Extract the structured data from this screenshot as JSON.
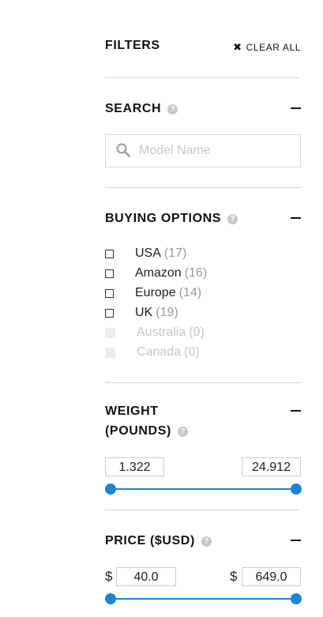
{
  "header": {
    "title": "FILTERS",
    "clear_all_label": "CLEAR ALL"
  },
  "search": {
    "title": "SEARCH",
    "help_glyph": "?",
    "placeholder": "Model Name",
    "value": ""
  },
  "buying_options": {
    "title": "BUYING OPTIONS",
    "help_glyph": "?",
    "items": [
      {
        "label": "USA",
        "count": "(17)",
        "enabled": true
      },
      {
        "label": "Amazon",
        "count": "(16)",
        "enabled": true
      },
      {
        "label": "Europe",
        "count": "(14)",
        "enabled": true
      },
      {
        "label": "UK",
        "count": "(19)",
        "enabled": true
      },
      {
        "label": "Australia",
        "count": "(0)",
        "enabled": false
      },
      {
        "label": "Canada",
        "count": "(0)",
        "enabled": false
      }
    ]
  },
  "weight": {
    "title_line1": "WEIGHT",
    "title_line2": "(POUNDS)",
    "help_glyph": "?",
    "min": "1.322",
    "max": "24.912"
  },
  "price": {
    "title": "PRICE ($USD)",
    "help_glyph": "?",
    "currency": "$",
    "min": "40.0",
    "max": "649.0"
  },
  "colors": {
    "accent": "#1a86d8",
    "divider": "#d6d6d6",
    "muted": "#9a9a9a",
    "disabled": "#c6c6c6"
  },
  "icons": {
    "clear": "close-icon",
    "search": "search-icon",
    "help": "help-icon",
    "collapse": "minus-icon"
  }
}
